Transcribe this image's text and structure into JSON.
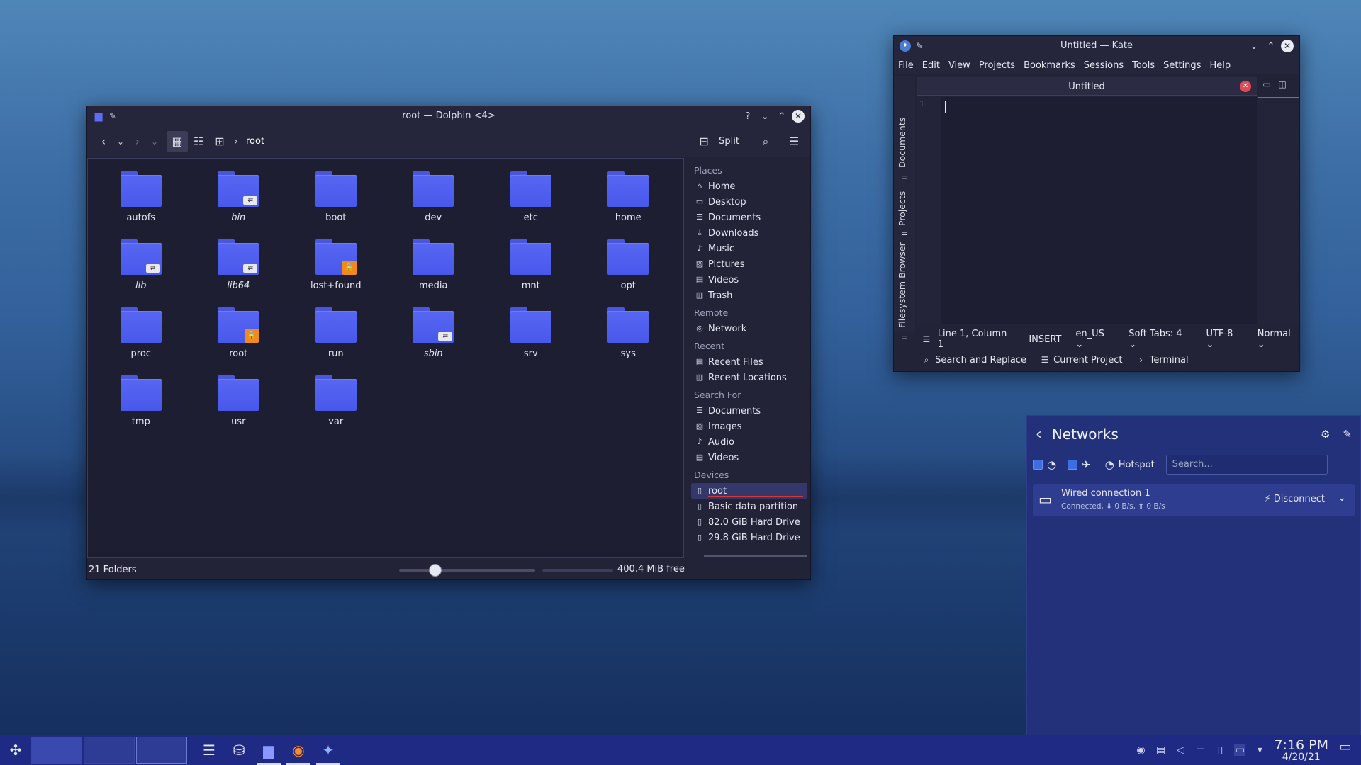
{
  "dolphin": {
    "title": "root — Dolphin <4>",
    "help": "?",
    "breadcrumb": "root",
    "split_label": "Split",
    "folders": [
      {
        "name": "autofs",
        "badge": ""
      },
      {
        "name": "bin",
        "badge": "link"
      },
      {
        "name": "boot",
        "badge": ""
      },
      {
        "name": "dev",
        "badge": ""
      },
      {
        "name": "etc",
        "badge": ""
      },
      {
        "name": "home",
        "badge": ""
      },
      {
        "name": "lib",
        "badge": "link"
      },
      {
        "name": "lib64",
        "badge": "link"
      },
      {
        "name": "lost+found",
        "badge": "lock"
      },
      {
        "name": "media",
        "badge": ""
      },
      {
        "name": "mnt",
        "badge": ""
      },
      {
        "name": "opt",
        "badge": ""
      },
      {
        "name": "proc",
        "badge": ""
      },
      {
        "name": "root",
        "badge": "lock"
      },
      {
        "name": "run",
        "badge": ""
      },
      {
        "name": "sbin",
        "badge": "link"
      },
      {
        "name": "srv",
        "badge": ""
      },
      {
        "name": "sys",
        "badge": ""
      },
      {
        "name": "tmp",
        "badge": ""
      },
      {
        "name": "usr",
        "badge": ""
      },
      {
        "name": "var",
        "badge": ""
      }
    ],
    "places": {
      "places_header": "Places",
      "places": [
        "Home",
        "Desktop",
        "Documents",
        "Downloads",
        "Music",
        "Pictures",
        "Videos",
        "Trash"
      ],
      "remote_header": "Remote",
      "remote": [
        "Network"
      ],
      "recent_header": "Recent",
      "recent": [
        "Recent Files",
        "Recent Locations"
      ],
      "search_header": "Search For",
      "search": [
        "Documents",
        "Images",
        "Audio",
        "Videos"
      ],
      "devices_header": "Devices",
      "devices": [
        "root",
        "Basic data partition",
        "82.0 GiB Hard Drive",
        "29.8 GiB Hard Drive"
      ]
    },
    "status": "21 Folders",
    "free_space": "400.4 MiB free"
  },
  "kate": {
    "title": "Untitled — Kate",
    "menu": [
      "File",
      "Edit",
      "View",
      "Projects",
      "Bookmarks",
      "Sessions",
      "Tools",
      "Settings",
      "Help"
    ],
    "side_tabs": [
      "Documents",
      "Projects",
      "Filesystem Browser"
    ],
    "tab_label": "Untitled",
    "line_number": "1",
    "status": {
      "position": "Line 1, Column 1",
      "mode": "INSERT",
      "lang": "en_US",
      "tabs": "Soft Tabs: 4",
      "encoding": "UTF-8",
      "view_mode": "Normal"
    },
    "bottom": [
      "Search and Replace",
      "Current Project",
      "Terminal"
    ]
  },
  "networks": {
    "title": "Networks",
    "hotspot_label": "Hotspot",
    "search_placeholder": "Search...",
    "connection": {
      "name": "Wired connection 1",
      "status": "Connected, ⬇ 0 B/s, ⬆ 0 B/s",
      "action": "Disconnect"
    }
  },
  "taskbar": {
    "time": "7:16 PM",
    "date": "4/20/21"
  }
}
